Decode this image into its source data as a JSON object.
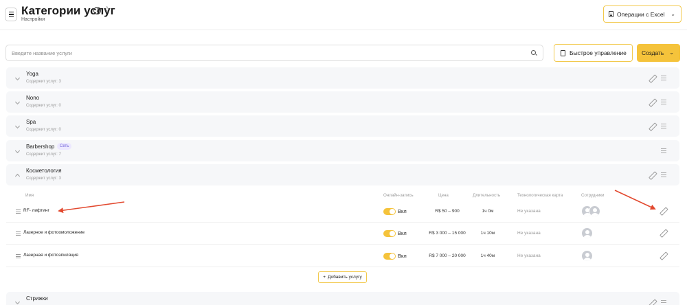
{
  "header": {
    "title": "Категории услуг",
    "subtitle": "Настройки",
    "excel_label": "Операции с Excel"
  },
  "toolbar": {
    "search_placeholder": "Введите название услуги",
    "quick_label": "Быстрое управление",
    "create_label": "Создать"
  },
  "categories": [
    {
      "name": "Yoga",
      "count": "Содержит услуг: 3"
    },
    {
      "name": "Nono",
      "count": "Содержит услуг: 0"
    },
    {
      "name": "Spa",
      "count": "Содержит услуг: 0"
    },
    {
      "name": "Barbershop",
      "count": "Содержит услуг: 7",
      "badge": "Сеть"
    },
    {
      "name": "Косметология",
      "count": "Содержит услуг: 3"
    },
    {
      "name": "Стрижки"
    }
  ],
  "table": {
    "headers": [
      "Имя",
      "Онлайн-запись",
      "Цена",
      "Длительность",
      "Технологическая карта",
      "Сотрудники"
    ],
    "rows": [
      {
        "name": "RF- лифтинг",
        "online": "Вкл",
        "price": "R$ 50 – 900",
        "duration": "1ч 0м",
        "card": "Не указана"
      },
      {
        "name": "Лазерное и фотоомоложение",
        "online": "Вкл",
        "price": "R$ 3 000 – 15 000",
        "duration": "1ч 10м",
        "card": "Не указана"
      },
      {
        "name": "Лазерная и фотоэпиляция",
        "online": "Вкл",
        "price": "R$ 7 000 – 20 000",
        "duration": "1ч 40м",
        "card": "Не указана"
      }
    ]
  },
  "add_service_label": "Добавить услугу",
  "colors": {
    "accent": "#f5c33b",
    "arrow": "#e2492f",
    "badge_text": "#6b5cd6"
  }
}
